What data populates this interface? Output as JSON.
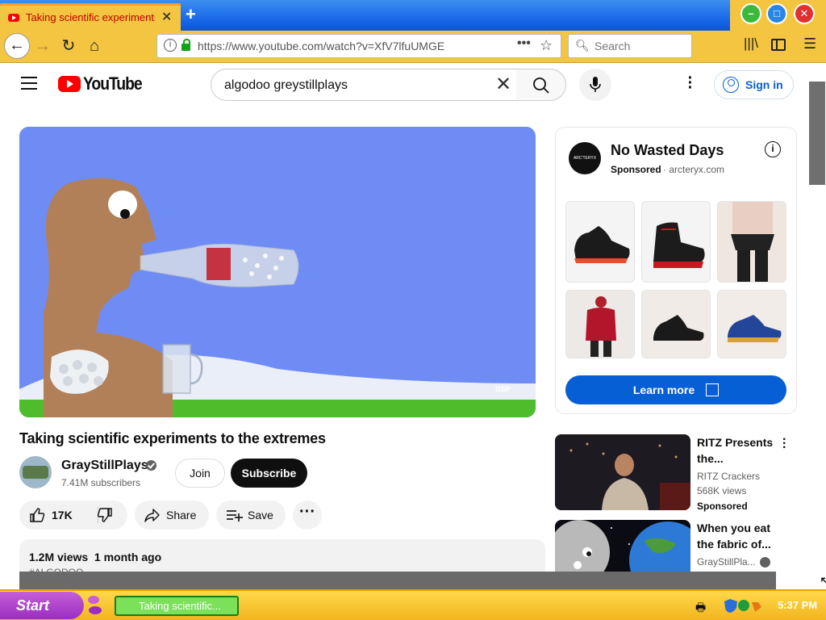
{
  "browser": {
    "tab_title": "Taking scientific experiments to the extremes",
    "tab_close": "✕",
    "new_tab": "+",
    "url": "https://www.youtube.com/watch?v=XfV7lfuUMGE",
    "url_menu": "•••",
    "search_placeholder": "Search"
  },
  "youtube": {
    "logo_text": "YouTube",
    "search_query": "algodoo greystillplays",
    "sign_in": "Sign in"
  },
  "video": {
    "title": "Taking scientific experiments to the extremes",
    "channel": "GrayStillPlays",
    "subscribers": "7.41M subscribers",
    "join_label": "Join",
    "subscribe_label": "Subscribe",
    "likes": "17K",
    "share_label": "Share",
    "save_label": "Save",
    "more_label": "···",
    "views_date": "1.2M views  1 month ago",
    "description_tag": "#ALGODOO"
  },
  "ad": {
    "title": "No Wasted Days",
    "sponsored": "Sponsored",
    "domain": "· arcteryx.com",
    "logo_text": "ARC'TERYX",
    "cta": "Learn more",
    "tiles": [
      "black-red-trail-shoe",
      "black-red-hiking-boot",
      "climbing-harness",
      "red-jacket",
      "black-approach-shoe",
      "blue-trail-shoe"
    ]
  },
  "related": [
    {
      "title": "RITZ Presents the...",
      "channel": "RITZ Crackers",
      "views": "568K views",
      "badge": "Sponsored"
    },
    {
      "title": "When you eat the fabric of...",
      "channel": "GrayStillPla..."
    }
  ],
  "taskbar": {
    "start_label": "Start",
    "task_label": "Taking scientific...",
    "clock": "5:37 PM"
  },
  "colors": {
    "youtube_red": "#ff0000",
    "link_blue": "#065fd4",
    "taskbar_yellow": "#f3c540",
    "start_purple": "#9a2ec0"
  }
}
